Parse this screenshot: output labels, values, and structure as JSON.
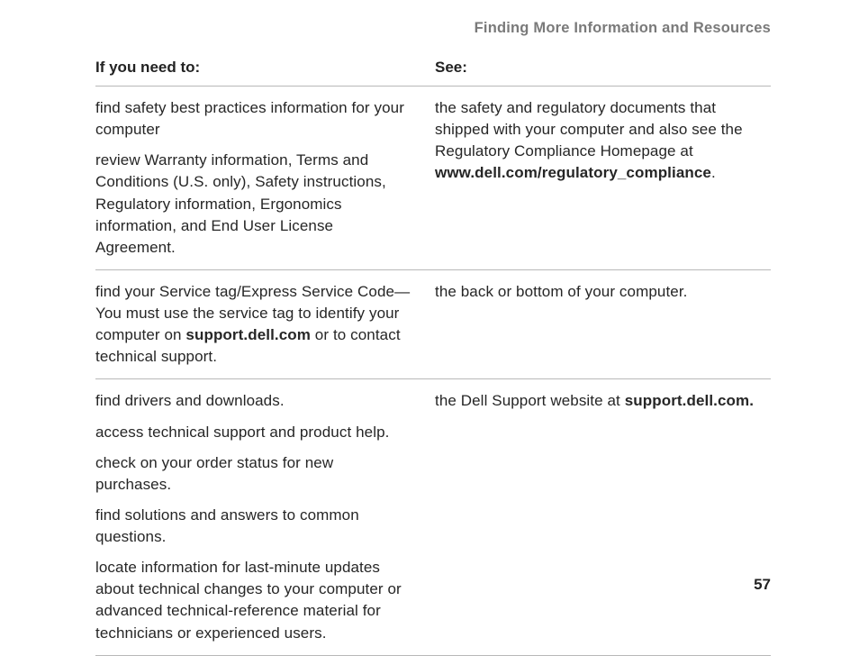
{
  "header": "Finding More Information and Resources",
  "pageNumber": "57",
  "table": {
    "col1Header": "If you need to:",
    "col2Header": "See:",
    "row1": {
      "leftP1": "find safety best practices information for your computer",
      "leftP2": "review Warranty information, Terms and Conditions (U.S. only), Safety instructions, Regulatory information, Ergonomics information, and End User License Agreement.",
      "rightPrefix": "the safety and regulatory documents that shipped with your computer and also see the Regulatory Compliance Homepage at ",
      "rightBold": "www.dell.com/regulatory_compliance",
      "rightSuffix": "."
    },
    "row2": {
      "leftPrefix": "find your Service tag/Express Service Code—You must use the service tag to identify your computer on ",
      "leftBold": "support.dell.com",
      "leftSuffix": " or to contact technical support.",
      "right": "the back or bottom of your computer."
    },
    "row3": {
      "leftP1": "find drivers and downloads.",
      "leftP2": "access technical support and product help.",
      "leftP3": "check on your order status for new purchases.",
      "leftP4": "find solutions and answers to common questions.",
      "leftP5": "locate information for last-minute updates about technical changes to your computer or advanced technical-reference material for technicians or experienced users.",
      "rightPrefix": "the Dell Support website at ",
      "rightBold": "support.dell.com."
    }
  }
}
